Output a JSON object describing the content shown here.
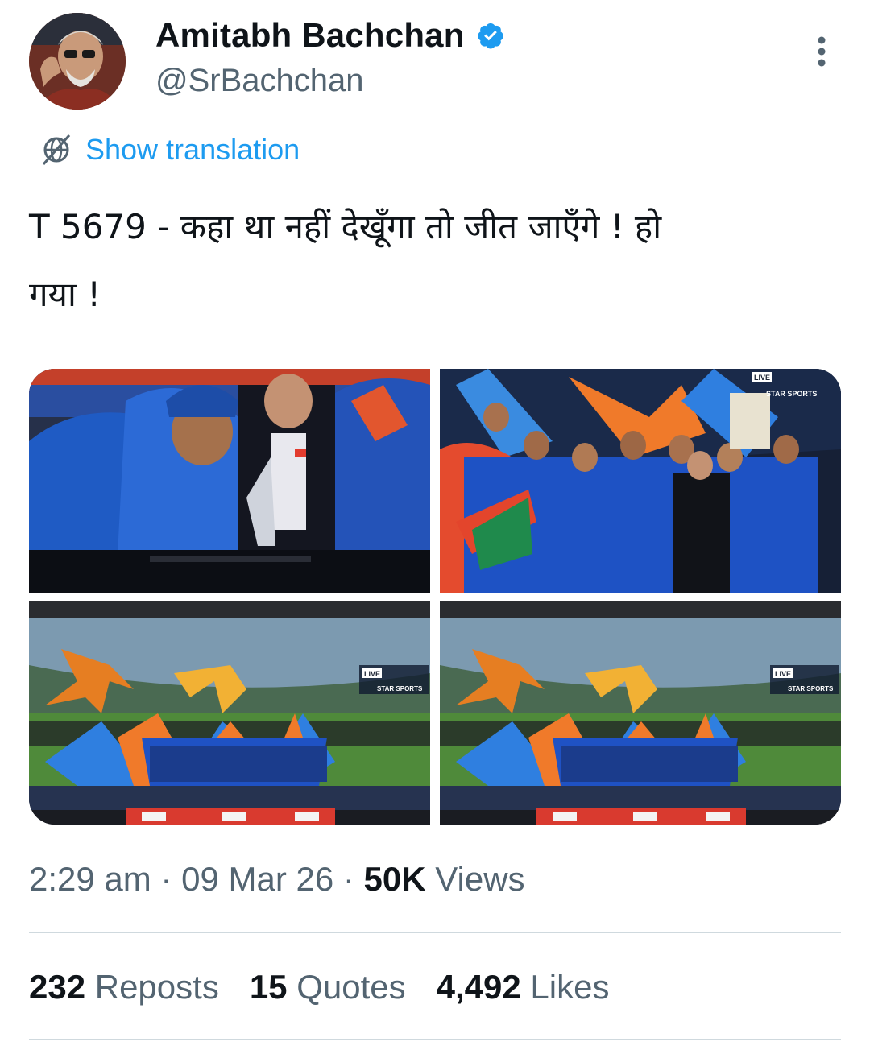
{
  "author": {
    "name": "Amitabh Bachchan",
    "handle": "@SrBachchan",
    "verified_icon": "verified-badge-icon"
  },
  "translation": {
    "label": "Show translation",
    "icon": "globe-slash-icon"
  },
  "tweet": {
    "text_line1": "T 5679 - कहा था नहीं देखूँगा तो जीत जाएँगे ! हो",
    "text_line2": "गया !"
  },
  "photos": {
    "p1": {
      "overlay_text": ""
    },
    "p2": {
      "live": "LIVE",
      "channel": "STAR SPORTS"
    },
    "p3": {
      "live": "LIVE",
      "channel": "STAR SPORTS"
    },
    "p4": {
      "live": "LIVE",
      "channel": "STAR SPORTS"
    }
  },
  "meta": {
    "time": "2:29 am",
    "sep1": " · ",
    "date": "09 Mar 26",
    "sep2": " · ",
    "views_count": "50K",
    "views_label": " Views"
  },
  "stats": {
    "reposts_count": "232",
    "reposts_label": " Reposts",
    "quotes_count": "15",
    "quotes_label": " Quotes",
    "likes_count": "4,492",
    "likes_label": " Likes"
  },
  "colors": {
    "accent": "#1d9bf0",
    "secondary_text": "#536471",
    "divider": "#cfd9de"
  }
}
